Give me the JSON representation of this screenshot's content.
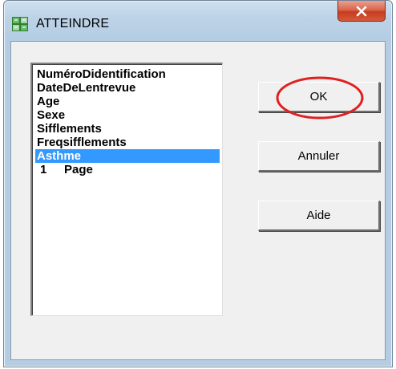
{
  "window": {
    "title": "ATTEINDRE",
    "icon": "sas-logo-icon",
    "close_icon": "close-icon"
  },
  "list": {
    "items": [
      {
        "label": "NuméroDidentification",
        "selected": false
      },
      {
        "label": "DateDeLentrevue",
        "selected": false
      },
      {
        "label": "Age",
        "selected": false
      },
      {
        "label": "Sexe",
        "selected": false
      },
      {
        "label": "Sifflements",
        "selected": false
      },
      {
        "label": "Freqsifflements",
        "selected": false
      },
      {
        "label": "Asthme",
        "selected": true
      }
    ],
    "page_row": {
      "number": "1",
      "label": "Page"
    }
  },
  "buttons": {
    "ok": "OK",
    "cancel": "Annuler",
    "help": "Aide"
  },
  "colors": {
    "selection": "#3399ff",
    "highlight_circle": "#e02020",
    "dialog_face": "#f0f0f0",
    "title_bar": "#bcd2e7",
    "close_button": "#c73c20"
  }
}
